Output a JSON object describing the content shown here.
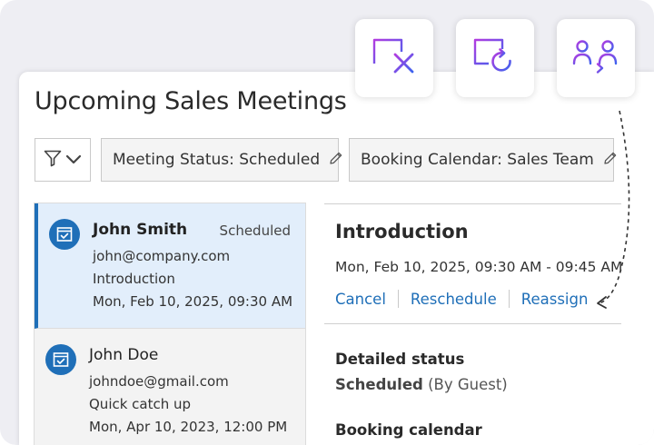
{
  "page": {
    "title": "Upcoming Sales Meetings"
  },
  "filters": {
    "filter_icon": "funnel-icon",
    "chips": [
      {
        "label": "Meeting Status: Scheduled",
        "icon": "pencil-icon"
      },
      {
        "label": "Booking Calendar: Sales Team",
        "icon": "pencil-icon"
      }
    ]
  },
  "floating_actions": [
    {
      "icon": "calendar-cancel-icon"
    },
    {
      "icon": "calendar-reschedule-icon"
    },
    {
      "icon": "users-reassign-icon"
    }
  ],
  "meetings": [
    {
      "name": "John Smith",
      "status": "Scheduled",
      "email": "john@company.com",
      "topic": "Introduction",
      "datetime": "Mon, Feb 10, 2025, 09:30 AM",
      "selected": true
    },
    {
      "name": "John Doe",
      "email": "johndoe@gmail.com",
      "topic": "Quick catch up",
      "datetime": "Mon, Apr 10, 2023, 12:00 PM",
      "selected": false
    }
  ],
  "detail": {
    "title": "Introduction",
    "time_range": "Mon, Feb 10, 2025, 09:30 AM - 09:45 AM",
    "actions": [
      "Cancel",
      "Reschedule",
      "Reassign"
    ],
    "detailed_status_label": "Detailed status",
    "status_value": "Scheduled",
    "status_note": "(By Guest)",
    "booking_calendar_label": "Booking calendar"
  },
  "colors": {
    "accent_blue": "#1f6fb8",
    "icon_gradient_start": "#b23ce0",
    "icon_gradient_end": "#3d63ee"
  }
}
